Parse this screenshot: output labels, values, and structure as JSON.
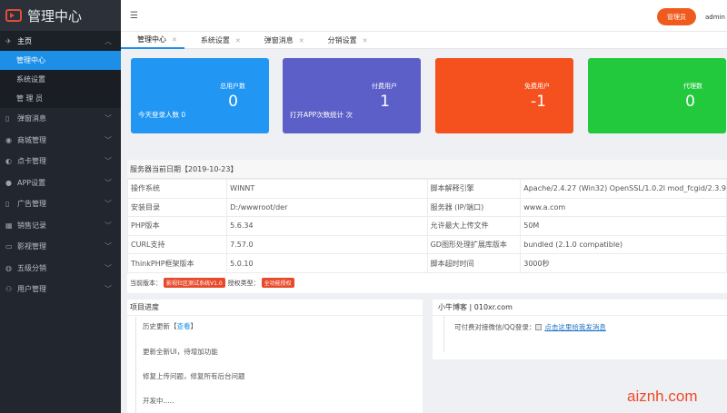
{
  "sidebar": {
    "logo": "管理中心",
    "home": "主页",
    "home_sub": [
      "管理中心",
      "系统设置",
      "管 理 员"
    ],
    "menu": [
      {
        "label": "弹窗消息",
        "icon": "phone-icon"
      },
      {
        "label": "商城管理",
        "icon": "shop-icon"
      },
      {
        "label": "点卡管理",
        "icon": "card-icon"
      },
      {
        "label": "APP设置",
        "icon": "app-icon"
      },
      {
        "label": "广告管理",
        "icon": "ad-icon"
      },
      {
        "label": "销售记录",
        "icon": "record-icon"
      },
      {
        "label": "影视管理",
        "icon": "film-icon"
      },
      {
        "label": "五级分销",
        "icon": "share-icon"
      },
      {
        "label": "用户管理",
        "icon": "user-icon"
      }
    ]
  },
  "header": {
    "manager_button": "管理员",
    "admin": "admin"
  },
  "tabs": [
    {
      "label": "管理中心"
    },
    {
      "label": "系统设置"
    },
    {
      "label": "弹窗消息"
    },
    {
      "label": "分销设置"
    }
  ],
  "cards": [
    {
      "label": "总用户数",
      "value": "0",
      "foot": "今天登录人数 0",
      "color": "#2196f3"
    },
    {
      "label": "付费用户",
      "value": "1",
      "foot": "打开APP次数统计 次",
      "color": "#5b5fc7"
    },
    {
      "label": "免费用户",
      "value": "-1",
      "foot": "",
      "color": "#f4511e"
    },
    {
      "label": "代理数",
      "value": "0",
      "foot": "",
      "color": "#22c93c"
    }
  ],
  "server": {
    "title": "服务器当前日期【2019-10-23】",
    "rows": [
      [
        "操作系统",
        "WINNT",
        "脚本解释引擎",
        "Apache/2.4.27 (Win32) OpenSSL/1.0.2l mod_fcgid/2.3.9"
      ],
      [
        "安装目录",
        "D:/wwwroot/der",
        "服务器 (IP/端口)",
        "www.a.com"
      ],
      [
        "PHP版本",
        "5.6.34",
        "允许最大上传文件",
        "50M"
      ],
      [
        "CURL支持",
        "7.57.0",
        "GD图形处理扩展库版本",
        "bundled (2.1.0 compatible)"
      ],
      [
        "ThinkPHP框架版本",
        "5.0.10",
        "脚本超时时间",
        "3000秒"
      ]
    ],
    "version_label": "当前版本：",
    "version_tag": "影视社区测试系统V1.0",
    "license_label": "授权类型：",
    "license_tag": "全功能授权"
  },
  "progress": {
    "title": "项目进度",
    "items": [
      {
        "text": "历史更新【",
        "link": "查看",
        "end": "】"
      },
      {
        "text": "更新全新UI，待增加功能"
      },
      {
        "text": "修复上传问题，修复所有后台问题"
      },
      {
        "text": "开发中....."
      }
    ]
  },
  "cow": {
    "title": "小牛博客 | 010xr.com",
    "text": "可付费对接微信/QQ登录：",
    "link": "点击这里给我发消息"
  },
  "watermark": "aiznh.com"
}
